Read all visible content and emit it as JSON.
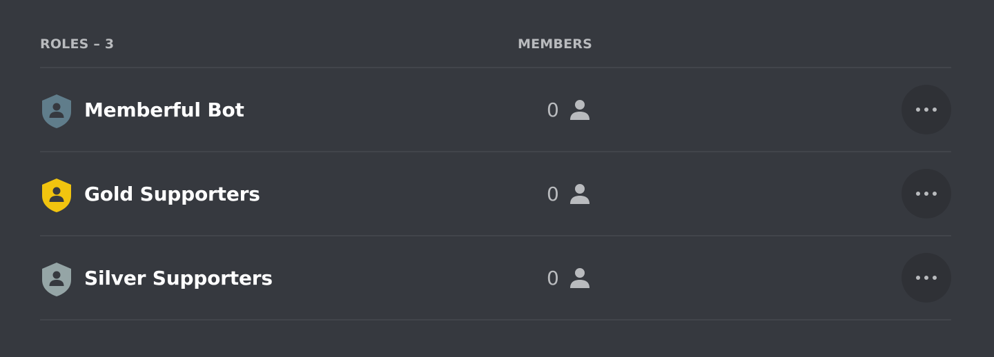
{
  "header": {
    "roles_label": "ROLES – 3",
    "members_label": "MEMBERS"
  },
  "roles": [
    {
      "name": "Memberful Bot",
      "members": "0",
      "color": "#607d8b",
      "icon": "shield-user-icon"
    },
    {
      "name": "Gold Supporters",
      "members": "0",
      "color": "#f1c40f",
      "icon": "shield-user-icon"
    },
    {
      "name": "Silver Supporters",
      "members": "0",
      "color": "#95a5a6",
      "icon": "shield-user-icon"
    }
  ],
  "icons": {
    "member": "person-icon",
    "more": "more-horizontal-icon"
  },
  "colors": {
    "background": "#36393f",
    "divider": "#42454b",
    "header_text": "#b9bbbe",
    "name_text": "#ffffff",
    "count_text": "#b9bbbe",
    "button_bg": "#2f3136"
  }
}
